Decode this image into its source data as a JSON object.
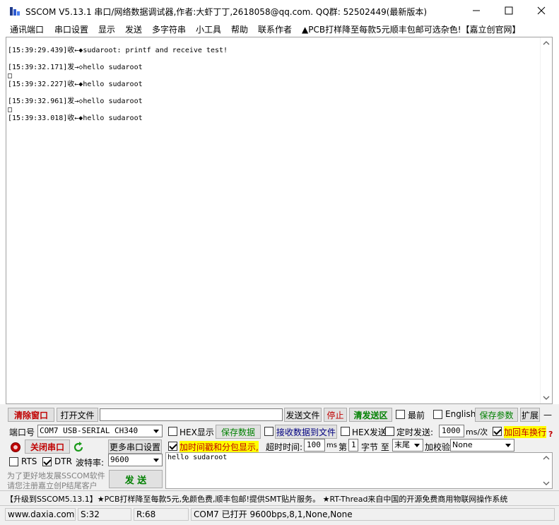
{
  "window": {
    "title": "SSCOM V5.13.1 串口/网络数据调试器,作者:大虾丁丁,2618058@qq.com. QQ群: 52502449(最新版本)"
  },
  "menu": [
    "通讯端口",
    "串口设置",
    "显示",
    "发送",
    "多字符串",
    "小工具",
    "帮助",
    "联系作者",
    "▲PCB打样降至每款5元顺丰包邮可选杂色!【嘉立创官网】"
  ],
  "log_lines": [
    "[15:39:29.439]收←◆sudaroot: printf and receive test!",
    "",
    "[15:39:32.171]发→◇hello sudaroot",
    "□",
    "[15:39:32.227]收←◆hello sudaroot",
    "",
    "[15:39:32.961]发→◇hello sudaroot",
    "□",
    "[15:39:33.018]收←◆hello sudaroot"
  ],
  "toolbar": {
    "clear_window": "清除窗口",
    "open_file": "打开文件",
    "file_path": "",
    "send_file": "发送文件",
    "stop": "停止",
    "clear_send": "清发送区",
    "topmost": "最前",
    "english": "English",
    "save_params": "保存参数",
    "expand": "扩展",
    "dash": "—"
  },
  "port": {
    "port_label": "端口号",
    "port_value": "COM7 USB-SERIAL CH340",
    "close_port": "关闭串口",
    "more_settings": "更多串口设置",
    "rts": "RTS",
    "dtr": "DTR",
    "baud_label": "波特率:",
    "baud_value": "9600",
    "promo_line1": "为了更好地发展SSCOM软件",
    "promo_line2": "请您注册嘉立创P结尾客户",
    "send": "发 送"
  },
  "options": {
    "hex_display": "HEX显示",
    "save_data": "保存数据",
    "recv_to_file": "接收数据到文件",
    "hex_send": "HEX发送",
    "timed_send": "定时发送:",
    "timed_interval": "1000",
    "interval_unit": "ms/次",
    "add_newline": "加回车换行",
    "timestamp": "加时间戳和分包显示,",
    "timeout_label": "超时时间:",
    "timeout_value": "100",
    "ms": "ms",
    "nth_label": "第",
    "nth_value": "1",
    "byte_label": "字节 至",
    "end_value": "末尾",
    "checksum_label": "加校验",
    "checksum_value": "None",
    "question": "?"
  },
  "send_text": "hello sudaroot",
  "ad": "【升级到SSCOM5.13.1】★PCB打样降至每款5元,免颜色费,顺丰包邮!提供SMT贴片服务。 ★RT-Thread来自中国的开源免费商用物联网操作系统",
  "status": {
    "website": "www.daxia.com",
    "sent": "S:32",
    "received": "R:68",
    "port_state": "COM7 已打开  9600bps,8,1,None,None"
  },
  "colors": {
    "accent_red": "#c00000",
    "accent_green": "#008000",
    "highlight_yellow": "#ffff00"
  }
}
